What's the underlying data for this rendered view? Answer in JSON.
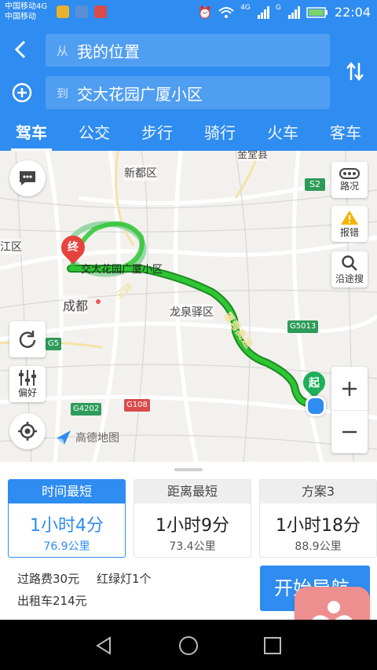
{
  "status_bar": {
    "carrier1": "中国移动4G",
    "carrier2": "中国移动",
    "time": "22:04",
    "net1": "4G",
    "net2": "G"
  },
  "route_form": {
    "from_prefix": "从",
    "from_value": "我的位置",
    "to_prefix": "到",
    "to_value": "交大花园广厦小区"
  },
  "tabs": [
    {
      "label": "驾车",
      "active": true
    },
    {
      "label": "公交"
    },
    {
      "label": "步行"
    },
    {
      "label": "骑行"
    },
    {
      "label": "火车"
    },
    {
      "label": "客车"
    }
  ],
  "map": {
    "labels": {
      "xindu": "新都区",
      "jinjiang": "江区",
      "chengdu": "成都",
      "longquanyi": "龙泉驿区",
      "jintang": "金堂县",
      "destination": "交大花园广厦小区",
      "ring_road": "三环",
      "expressway": "厦蓉高速",
      "s2": "S2",
      "g5013": "G5013",
      "g5": "G5",
      "g4202": "G4202",
      "g108": "G108",
      "end_marker": "终",
      "start_marker": "起",
      "logo": "高德地图"
    },
    "buttons": {
      "traffic": "路况",
      "report": "报错",
      "along_search": "沿途搜",
      "preference": "偏好"
    }
  },
  "plans": [
    {
      "head": "时间最短",
      "time": "1小时4分",
      "distance": "76.9公里",
      "active": true
    },
    {
      "head": "距离最短",
      "time": "1小时9分",
      "distance": "73.4公里"
    },
    {
      "head": "方案3",
      "time": "1小时18分",
      "distance": "88.9公里"
    }
  ],
  "trip_info": {
    "toll": "过路费30元",
    "traffic_lights": "红绿灯1个",
    "taxi": "出租车214元"
  },
  "start_button": "开始导航",
  "colors": {
    "primary": "#2f8cf0",
    "route": "#22b02a",
    "marker_end": "#e8423c",
    "marker_start": "#1fae5a"
  }
}
